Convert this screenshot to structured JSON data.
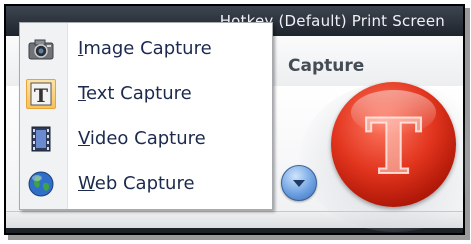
{
  "window": {
    "title": "Hotkey (Default) Print Screen"
  },
  "panel": {
    "capture_label": "Capture",
    "capture_button_glyph": "T"
  },
  "menu": {
    "items": [
      {
        "label": "Image Capture",
        "mnemonic": "I",
        "rest": "mage Capture",
        "icon": "camera-icon",
        "selected": false
      },
      {
        "label": "Text Capture",
        "mnemonic": "T",
        "rest": "ext Capture",
        "icon": "text-t-icon",
        "selected": true
      },
      {
        "label": "Video Capture",
        "mnemonic": "V",
        "rest": "ideo Capture",
        "icon": "film-icon",
        "selected": false
      },
      {
        "label": "Web Capture",
        "mnemonic": "W",
        "rest": "eb Capture",
        "icon": "globe-icon",
        "selected": false
      }
    ]
  },
  "colors": {
    "capture_button": "#d62b16",
    "dropdown_button": "#6fa2e2",
    "selected_icon_highlight": "#f8c25b",
    "menu_text": "#1c2a4e"
  }
}
